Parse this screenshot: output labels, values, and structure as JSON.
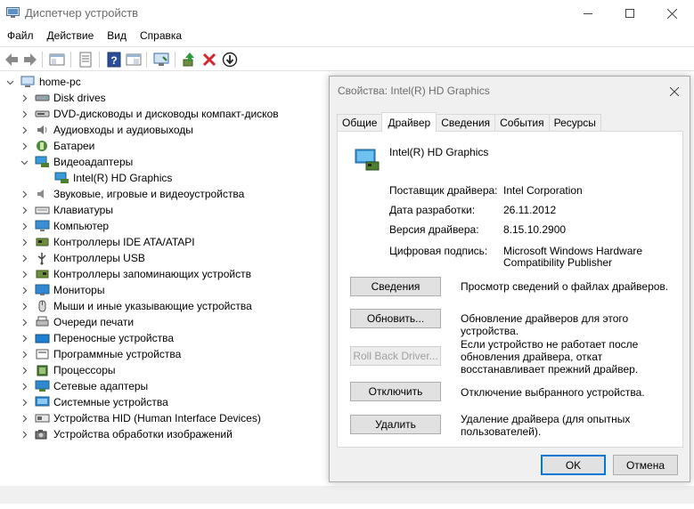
{
  "window": {
    "title": "Диспетчер устройств"
  },
  "menu": [
    "Файл",
    "Действие",
    "Вид",
    "Справка"
  ],
  "toolbar": {
    "icons": [
      "back-icon",
      "forward-icon",
      "properties-icon",
      "help-icon",
      "scan-hardware-icon",
      "update-driver-icon",
      "uninstall-icon",
      "disable-icon"
    ]
  },
  "tree": {
    "root": "home-pc",
    "items": [
      {
        "label": "Disk drives",
        "icon": "disk-drive-icon",
        "expanded": false
      },
      {
        "label": "DVD-дисководы и дисководы компакт-дисков",
        "icon": "dvd-drive-icon",
        "expanded": false
      },
      {
        "label": "Аудиовходы и аудиовыходы",
        "icon": "speaker-icon",
        "expanded": false
      },
      {
        "label": "Батареи",
        "icon": "battery-icon",
        "expanded": false
      },
      {
        "label": "Видеоадаптеры",
        "icon": "display-adapter-icon",
        "expanded": true
      },
      {
        "label": "Intel(R) HD Graphics",
        "icon": "display-adapter-icon",
        "child": true
      },
      {
        "label": "Звуковые, игровые и видеоустройства",
        "icon": "sound-icon",
        "expanded": false
      },
      {
        "label": "Клавиатуры",
        "icon": "keyboard-icon",
        "expanded": false
      },
      {
        "label": "Компьютер",
        "icon": "computer-icon",
        "expanded": false
      },
      {
        "label": "Контроллеры IDE ATA/ATAPI",
        "icon": "ide-controller-icon",
        "expanded": false
      },
      {
        "label": "Контроллеры USB",
        "icon": "usb-icon",
        "expanded": false
      },
      {
        "label": "Контроллеры запоминающих устройств",
        "icon": "storage-controller-icon",
        "expanded": false
      },
      {
        "label": "Мониторы",
        "icon": "monitor-icon",
        "expanded": false
      },
      {
        "label": "Мыши и иные указывающие устройства",
        "icon": "mouse-icon",
        "expanded": false
      },
      {
        "label": "Очереди печати",
        "icon": "printer-icon",
        "expanded": false
      },
      {
        "label": "Переносные устройства",
        "icon": "portable-device-icon",
        "expanded": false
      },
      {
        "label": "Программные устройства",
        "icon": "software-device-icon",
        "expanded": false
      },
      {
        "label": "Процессоры",
        "icon": "processor-icon",
        "expanded": false
      },
      {
        "label": "Сетевые адаптеры",
        "icon": "network-adapter-icon",
        "expanded": false
      },
      {
        "label": "Системные устройства",
        "icon": "system-device-icon",
        "expanded": false
      },
      {
        "label": "Устройства HID (Human Interface Devices)",
        "icon": "hid-icon",
        "expanded": false
      },
      {
        "label": "Устройства обработки изображений",
        "icon": "camera-icon",
        "expanded": false
      }
    ]
  },
  "dialog": {
    "title": "Свойства: Intel(R) HD Graphics",
    "tabs": [
      "Общие",
      "Драйвер",
      "Сведения",
      "События",
      "Ресурсы"
    ],
    "active_tab": "Драйвер",
    "device_name": "Intel(R) HD Graphics",
    "props": {
      "provider_label": "Поставщик драйвера:",
      "provider_value": "Intel Corporation",
      "date_label": "Дата разработки:",
      "date_value": "26.11.2012",
      "version_label": "Версия драйвера:",
      "version_value": "8.15.10.2900",
      "signer_label": "Цифровая подпись:",
      "signer_value_line1": "Microsoft Windows Hardware",
      "signer_value_line2": "Compatibility Publisher"
    },
    "actions": {
      "details_label": "Сведения",
      "details_desc": "Просмотр сведений о файлах драйверов.",
      "update_label": "Обновить...",
      "update_desc": "Обновление драйверов для этого устройства.",
      "rollback_label": "Roll Back Driver...",
      "rollback_desc_1": "Если устройство не работает после",
      "rollback_desc_2": "обновления драйвера, откат",
      "rollback_desc_3": "восстанавливает прежний драйвер.",
      "disable_label": "Отключить",
      "disable_desc": "Отключение выбранного устройства.",
      "uninstall_label": "Удалить",
      "uninstall_desc_1": "Удаление драйвера (для опытных",
      "uninstall_desc_2": "пользователей)."
    },
    "ok_label": "OK",
    "cancel_label": "Отмена"
  }
}
